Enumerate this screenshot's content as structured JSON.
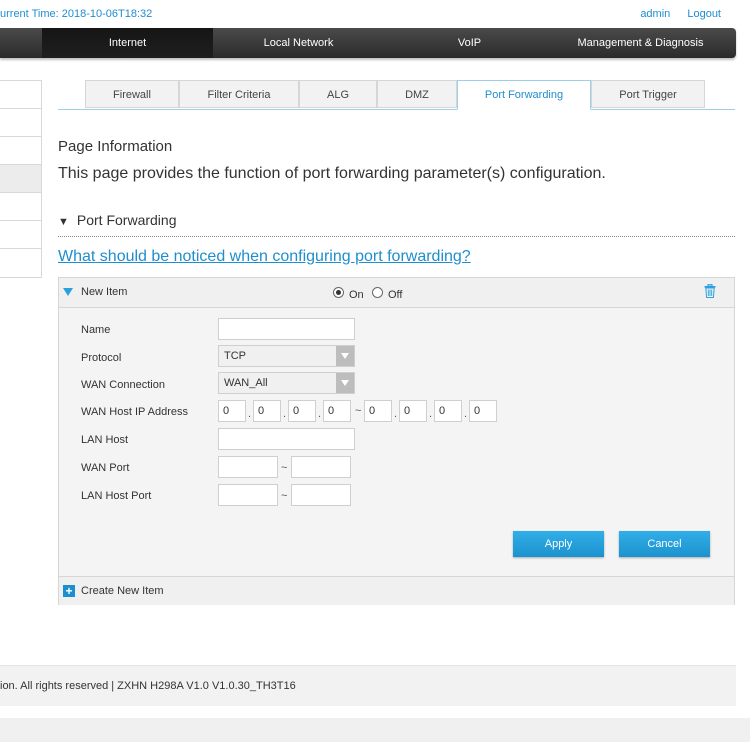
{
  "header": {
    "current_time": "urrent Time: 2018-10-06T18:32",
    "user": "admin",
    "logout": "Logout"
  },
  "nav": {
    "items": [
      "Internet",
      "Local Network",
      "VoIP",
      "Management & Diagnosis"
    ],
    "active": "Internet"
  },
  "tabs": {
    "items": [
      "Firewall",
      "Filter Criteria",
      "ALG",
      "DMZ",
      "Port Forwarding",
      "Port Trigger"
    ],
    "active": "Port Forwarding"
  },
  "page_info": {
    "title": "Page Information",
    "text": "This page provides the function of port forwarding parameter(s) configuration."
  },
  "section": {
    "title": "Port Forwarding",
    "notice_link": "What should be noticed when configuring port forwarding?"
  },
  "item": {
    "title": "New Item",
    "on_label": "On",
    "off_label": "Off",
    "selected": "On",
    "fields": {
      "name_label": "Name",
      "name_value": "",
      "protocol_label": "Protocol",
      "protocol_value": "TCP",
      "wan_connection_label": "WAN Connection",
      "wan_connection_value": "WAN_All",
      "wan_host_ip_label": "WAN Host IP Address",
      "wan_ip_start": [
        "0",
        "0",
        "0",
        "0"
      ],
      "wan_ip_end": [
        "0",
        "0",
        "0",
        "0"
      ],
      "lan_host_label": "LAN Host",
      "lan_host_value": "",
      "wan_port_label": "WAN Port",
      "lan_host_port_label": "LAN Host Port"
    },
    "apply": "Apply",
    "cancel": "Cancel"
  },
  "create_new": "Create New Item",
  "footer": {
    "text": "ion. All rights reserved  |   ZXHN H298A V1.0 V1.0.30_TH3T16"
  },
  "colors": {
    "accent": "#1e8ecf",
    "nav_bg": "#333333",
    "button": "#1b92cf"
  }
}
